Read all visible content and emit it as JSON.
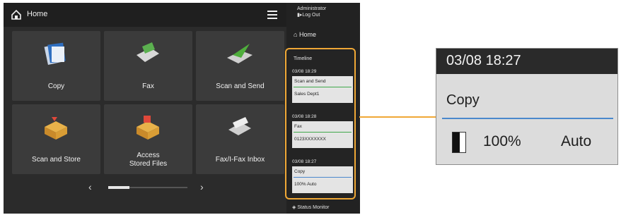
{
  "header": {
    "title": "Home",
    "menu_icon": "hamburger-icon"
  },
  "tiles": [
    {
      "label": "Copy",
      "icon": "copy-icon"
    },
    {
      "label": "Fax",
      "icon": "fax-icon"
    },
    {
      "label": "Scan and Send",
      "icon": "scan-send-icon"
    },
    {
      "label": "Scan and Store",
      "icon": "scan-store-icon"
    },
    {
      "label": "Access\nStored Files",
      "icon": "stored-files-icon"
    },
    {
      "label": "Fax/I-Fax Inbox",
      "icon": "inbox-icon"
    }
  ],
  "pager": {
    "prev": "‹",
    "next": "›"
  },
  "sidebar": {
    "user": "Administrator",
    "logout": "Log Out",
    "home_label": "Home",
    "timeline_title": "Timeline",
    "jobs": [
      {
        "time": "03/08 18:29",
        "name": "Scan and Send",
        "detail": "Sales Dept1",
        "color": "#3fa84a"
      },
      {
        "time": "03/08 18:28",
        "name": "Fax",
        "detail": "0123XXXXXXX",
        "color": "#3fa84a"
      },
      {
        "time": "03/08 18:27",
        "name": "Copy",
        "detail": "100%    Auto",
        "color": "#4a88cc"
      }
    ],
    "status_monitor": "Status Monitor"
  },
  "zoom": {
    "time": "03/08 18:27",
    "name": "Copy",
    "ratio": "100%",
    "mode": "Auto"
  },
  "accent": "#f0a836"
}
